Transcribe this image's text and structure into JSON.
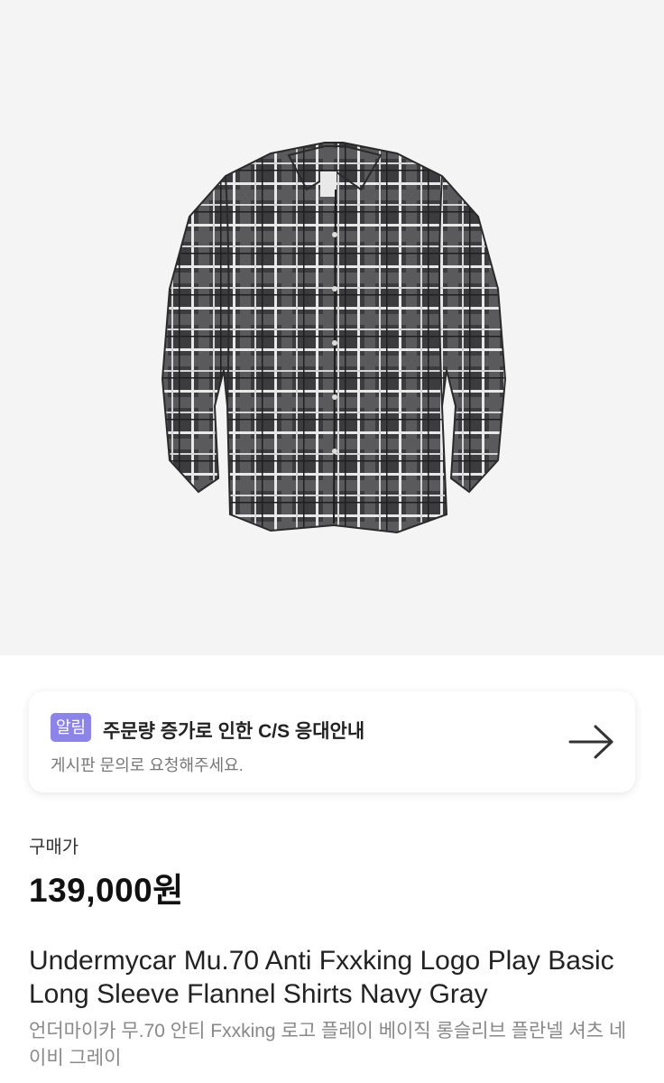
{
  "product_image": {
    "icon": "plaid-flannel-shirt-image"
  },
  "notice": {
    "badge": "알림",
    "title": "주문량 증가로 인한 C/S 응대안내",
    "subtitle": "게시판 문의로 요청해주세요.",
    "arrow_icon": "arrow-right-icon",
    "badge_color": "#8c84e8"
  },
  "price": {
    "label": "구매가",
    "value": "139,000원"
  },
  "product": {
    "title_en": "Undermycar Mu.70 Anti Fxxking Logo Play Basic Long Sleeve Flannel Shirts Navy Gray",
    "title_ko": "언더마이카 무.70 안티 Fxxking 로고 플레이 베이직 롱슬리브 플란넬 셔츠 네이비 그레이"
  }
}
